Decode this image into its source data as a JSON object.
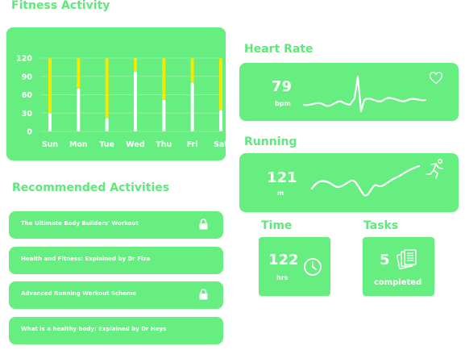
{
  "fitness": {
    "heading": "Fitness Activity",
    "chart_data": {
      "type": "bar",
      "categories": [
        "Sun",
        "Mon",
        "Tue",
        "Wed",
        "Thu",
        "Fri",
        "Sat"
      ],
      "ylim": [
        0,
        120
      ],
      "yticks": [
        "0",
        "30",
        "60",
        "90",
        "120"
      ],
      "series": [
        {
          "values": [
            30,
            70,
            22,
            98,
            52,
            80,
            35
          ],
          "color": "#ffffff"
        },
        {
          "values": [
            90,
            50,
            98,
            22,
            68,
            40,
            85
          ],
          "color": "#f5e900"
        }
      ]
    }
  },
  "recommended": {
    "heading": "Recommended Activities",
    "items": [
      {
        "title": "The Ultimate Body Builders' Workout",
        "locked": true
      },
      {
        "title": "Health and Fitness: Explained by Dr Fiza",
        "locked": false
      },
      {
        "title": "Advanced Running Workout Scheme",
        "locked": true
      },
      {
        "title": "What is a healthy body: Explained by Dr Heys",
        "locked": false
      }
    ]
  },
  "heart_rate": {
    "heading": "Heart Rate",
    "value": "79",
    "unit": "bpm",
    "icon": "heart-icon"
  },
  "running": {
    "heading": "Running",
    "value": "121",
    "unit": "m",
    "icon": "runner-icon"
  },
  "time": {
    "heading": "Time",
    "value": "122",
    "unit": "hrs",
    "icon": "clock-icon"
  },
  "tasks": {
    "heading": "Tasks",
    "value": "5",
    "unit": "completed",
    "icon": "documents-icon"
  }
}
